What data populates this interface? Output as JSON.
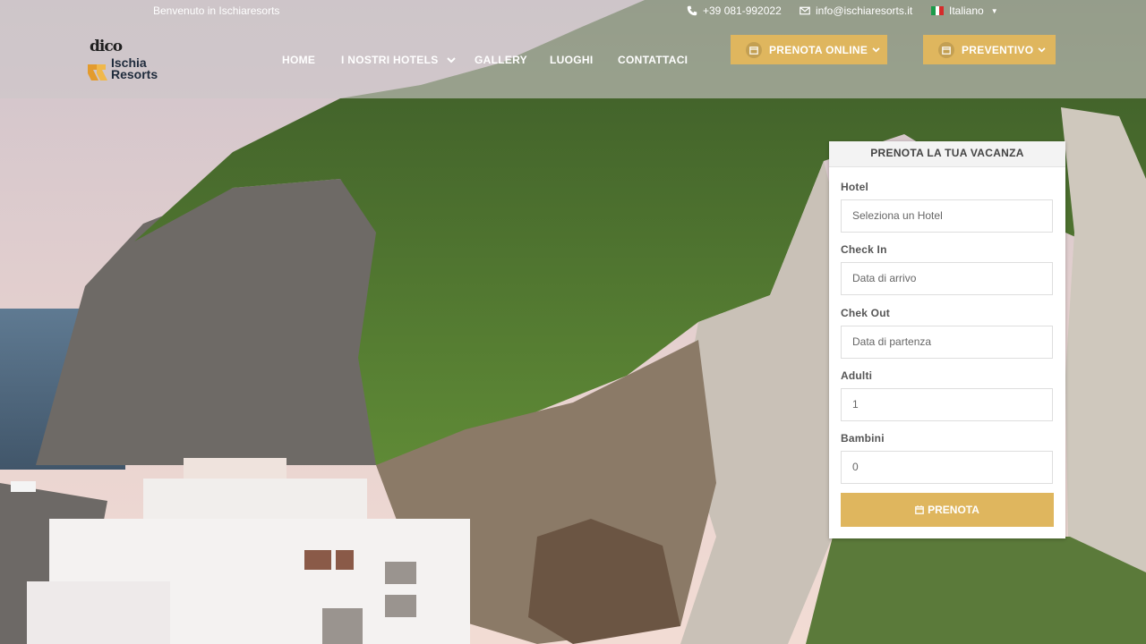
{
  "topbar": {
    "welcome": "Benvenuto in Ischiaresorts",
    "phone": "+39 081-992022",
    "email": "info@ischiaresorts.it",
    "language": "Italiano"
  },
  "brand": {
    "mark": "dico",
    "name_line1": "Ischia",
    "name_line2": "Resorts"
  },
  "nav": {
    "home": "HOME",
    "hotels": "I NOSTRI HOTELS",
    "gallery": "GALLERY",
    "luoghi": "LUOGHI",
    "contatti": "CONTATTACI"
  },
  "cta": {
    "book": "PRENOTA ONLINE",
    "quote": "PREVENTIVO"
  },
  "booking": {
    "title": "PRENOTA LA TUA VACANZA",
    "hotel_label": "Hotel",
    "hotel_placeholder": "Seleziona un Hotel",
    "checkin_label": "Check In",
    "checkin_placeholder": "Data di arrivo",
    "checkout_label": "Chek Out",
    "checkout_placeholder": "Data di partenza",
    "adults_label": "Adulti",
    "adults_value": "1",
    "children_label": "Bambini",
    "children_value": "0",
    "submit": "PRENOTA"
  },
  "colors": {
    "accent": "#dfb65e",
    "header_overlay": "#cdc6c8"
  },
  "icons": [
    "phone-icon",
    "mail-icon",
    "italy-flag-icon",
    "calendar-icon",
    "chevron-down-icon"
  ]
}
